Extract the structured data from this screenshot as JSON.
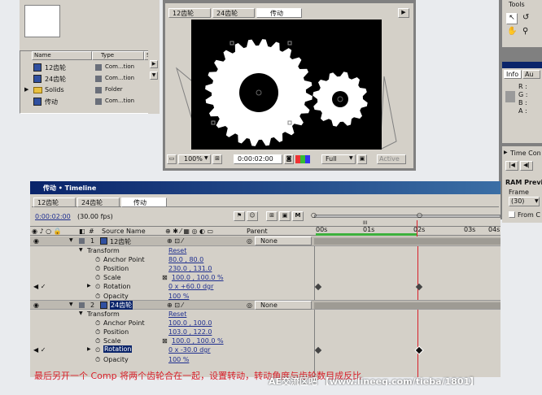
{
  "project": {
    "columns": [
      "Name",
      "Type",
      "Si"
    ],
    "items": [
      {
        "name": "12齿轮",
        "type": "Com...tion",
        "color": "#6a6f7a"
      },
      {
        "name": "24齿轮",
        "type": "Com...tion",
        "color": "#6a6f7a"
      },
      {
        "name": "Solids",
        "type": "Folder",
        "color": "#6a6f7a"
      },
      {
        "name": "传动",
        "type": "Com...tion",
        "color": "#6a6f7a"
      }
    ]
  },
  "comp_viewer": {
    "tabs": [
      "12齿轮",
      "24齿轮",
      "传动"
    ],
    "zoom": "100%",
    "timecode": "0:00:02:00",
    "resolution": "Full",
    "active_label": "Active"
  },
  "tools": {
    "title": "Tools"
  },
  "info": {
    "tabs": [
      "Info",
      "Au"
    ],
    "channels": [
      "R :",
      "G :",
      "B :",
      "A :"
    ]
  },
  "time_controls": {
    "title": "Time Con",
    "ram_preview": "RAM Previ",
    "frame_label": "Frame",
    "frame_value": "(30)",
    "from_label": "From C"
  },
  "timeline": {
    "title": "传动 • Timeline",
    "tabs": [
      "12齿轮",
      "24齿轮",
      "传动"
    ],
    "current_time": "0:00:02:00",
    "fps": "(30.00 fps)",
    "col_source": "Source Name",
    "col_parent": "Parent",
    "ruler": [
      "00s",
      "01s",
      "02s",
      "03s",
      "04s"
    ],
    "ruler_bars": "III",
    "layers": [
      {
        "index": "1",
        "name": "12齿轮",
        "parent": "None",
        "transform": "Transform",
        "reset": "Reset",
        "props": [
          {
            "name": "Anchor Point",
            "value": "80.0 , 80.0"
          },
          {
            "name": "Position",
            "value": "230.0 , 131.0"
          },
          {
            "name": "Scale",
            "value": "100.0 , 100.0 %"
          },
          {
            "name": "Rotation",
            "value": "0 x +60.0 dgr"
          },
          {
            "name": "Opacity",
            "value": "100 %"
          }
        ]
      },
      {
        "index": "2",
        "name": "24齿轮",
        "parent": "None",
        "transform": "Transform",
        "reset": "Reset",
        "props": [
          {
            "name": "Anchor Point",
            "value": "100.0 , 100.0"
          },
          {
            "name": "Position",
            "value": "103.0 , 122.0"
          },
          {
            "name": "Scale",
            "value": "100.0 , 100.0 %"
          },
          {
            "name": "Rotation",
            "value": "0 x -30.0 dgr"
          },
          {
            "name": "Opacity",
            "value": "100 %"
          }
        ]
      }
    ]
  },
  "caption": "最后另开一个 Comp 将两个齿轮合在一起，设置转动，转动角度与齿轮数目成反比",
  "watermark": "AE交流区吧 【www.lineeg.com/tieba/1801】",
  "colors": {
    "accent": "#d8202a",
    "title_bar": "#0a246a",
    "panel": "#d4d0c8",
    "caption": "#d8202a"
  }
}
